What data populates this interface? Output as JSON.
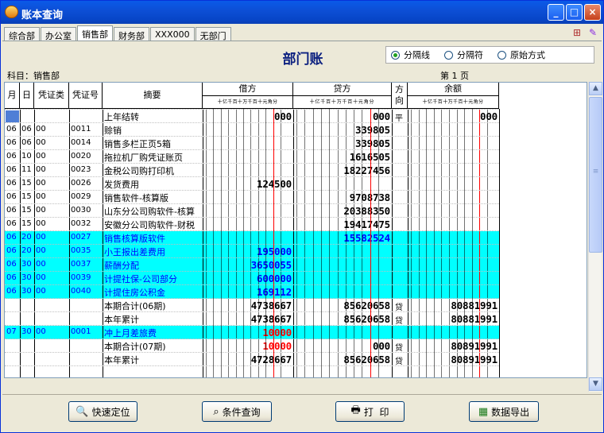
{
  "window": {
    "title": "账本查询",
    "min": "_",
    "max": "□",
    "close": "×"
  },
  "tabs": [
    "综合部",
    "办公室",
    "销售部",
    "财务部",
    "XXX000",
    "无部门"
  ],
  "tab_icons": [
    "⊞",
    "✎"
  ],
  "page_title": "部门账",
  "radios": [
    {
      "label": "分隔线",
      "checked": true
    },
    {
      "label": "分隔符",
      "checked": false
    },
    {
      "label": "原始方式",
      "checked": false
    }
  ],
  "subject": "科目：销售部",
  "page_no": "第 1 页",
  "headers": {
    "month": "月",
    "day": "日",
    "voucher_type": "凭证类",
    "voucher_no": "凭证号",
    "summary": "摘要",
    "debit": "借方",
    "credit": "贷方",
    "direction": "方向",
    "balance": "余额",
    "units": "十亿千百十万千百十元角分"
  },
  "rows": [
    {
      "m": "",
      "d": "",
      "t": "",
      "n": "",
      "s": "上年结转",
      "debit": "000",
      "credit": "000",
      "dir": "平",
      "bal": "000",
      "hl": false,
      "dred": false
    },
    {
      "m": "06",
      "d": "06",
      "t": "00",
      "n": "0011",
      "s": "赊销",
      "debit": "",
      "credit": "339805",
      "dir": "",
      "bal": "",
      "hl": false,
      "dred": false
    },
    {
      "m": "06",
      "d": "06",
      "t": "00",
      "n": "0014",
      "s": "销售多栏正页5箱",
      "debit": "",
      "credit": "339805",
      "dir": "",
      "bal": "",
      "hl": false,
      "dred": false
    },
    {
      "m": "06",
      "d": "10",
      "t": "00",
      "n": "0020",
      "s": "拖拉机厂购凭证账页",
      "debit": "",
      "credit": "1616505",
      "dir": "",
      "bal": "",
      "hl": false,
      "dred": false
    },
    {
      "m": "06",
      "d": "11",
      "t": "00",
      "n": "0023",
      "s": "金税公司购打印机",
      "debit": "",
      "credit": "18227456",
      "dir": "",
      "bal": "",
      "hl": false,
      "dred": false
    },
    {
      "m": "06",
      "d": "15",
      "t": "00",
      "n": "0026",
      "s": "发货费用",
      "debit": "124500",
      "credit": "",
      "dir": "",
      "bal": "",
      "hl": false,
      "dred": false
    },
    {
      "m": "06",
      "d": "15",
      "t": "00",
      "n": "0029",
      "s": "销售软件-核算版",
      "debit": "",
      "credit": "9708738",
      "dir": "",
      "bal": "",
      "hl": false,
      "dred": false
    },
    {
      "m": "06",
      "d": "15",
      "t": "00",
      "n": "0030",
      "s": "山东分公司购软件-核算",
      "debit": "",
      "credit": "20388350",
      "dir": "",
      "bal": "",
      "hl": false,
      "dred": false
    },
    {
      "m": "06",
      "d": "15",
      "t": "00",
      "n": "0032",
      "s": "安徽分公司购软件-财税",
      "debit": "",
      "credit": "19417475",
      "dir": "",
      "bal": "",
      "hl": false,
      "dred": false
    },
    {
      "m": "06",
      "d": "20",
      "t": "00",
      "n": "0027",
      "s": "销售核算版软件",
      "debit": "",
      "credit": "15582524",
      "dir": "",
      "bal": "",
      "hl": true,
      "dred": false
    },
    {
      "m": "06",
      "d": "20",
      "t": "00",
      "n": "0035",
      "s": "小王报出差费用",
      "debit": "195000",
      "credit": "",
      "dir": "",
      "bal": "",
      "hl": true,
      "dred": false
    },
    {
      "m": "06",
      "d": "30",
      "t": "00",
      "n": "0037",
      "s": "薪酬分配",
      "debit": "3650055",
      "credit": "",
      "dir": "",
      "bal": "",
      "hl": true,
      "dred": false
    },
    {
      "m": "06",
      "d": "30",
      "t": "00",
      "n": "0039",
      "s": "计提社保-公司部分",
      "debit": "600000",
      "credit": "",
      "dir": "",
      "bal": "",
      "hl": true,
      "dred": false
    },
    {
      "m": "06",
      "d": "30",
      "t": "00",
      "n": "0040",
      "s": "计提住房公积金",
      "debit": "169112",
      "credit": "",
      "dir": "",
      "bal": "",
      "hl": true,
      "dred": false
    },
    {
      "m": "",
      "d": "",
      "t": "",
      "n": "",
      "s": "本期合计(06期)",
      "debit": "4738667",
      "credit": "85620658",
      "dir": "贷",
      "bal": "80881991",
      "hl": false,
      "dred": false
    },
    {
      "m": "",
      "d": "",
      "t": "",
      "n": "",
      "s": "本年累计",
      "debit": "4738667",
      "credit": "85620658",
      "dir": "贷",
      "bal": "80881991",
      "hl": false,
      "dred": false
    },
    {
      "m": "07",
      "d": "30",
      "t": "00",
      "n": "0001",
      "s": "冲上月差旅费",
      "debit": "10000",
      "credit": "",
      "dir": "",
      "bal": "",
      "hl": true,
      "dred": true
    },
    {
      "m": "",
      "d": "",
      "t": "",
      "n": "",
      "s": "本期合计(07期)",
      "debit": "10000",
      "credit": "000",
      "dir": "贷",
      "bal": "80891991",
      "hl": false,
      "dred": true
    },
    {
      "m": "",
      "d": "",
      "t": "",
      "n": "",
      "s": "本年累计",
      "debit": "4728667",
      "credit": "85620658",
      "dir": "贷",
      "bal": "80891991",
      "hl": false,
      "dred": false
    }
  ],
  "buttons": [
    {
      "label": "快速定位",
      "icon": "🔍"
    },
    {
      "label": "条件查询",
      "icon": "⌕"
    },
    {
      "label": "打  印",
      "icon": "🖶"
    },
    {
      "label": "数据导出",
      "icon": "▦"
    }
  ],
  "scrollbar": {
    "up": "▲",
    "down": "▼",
    "grip": "≡"
  }
}
